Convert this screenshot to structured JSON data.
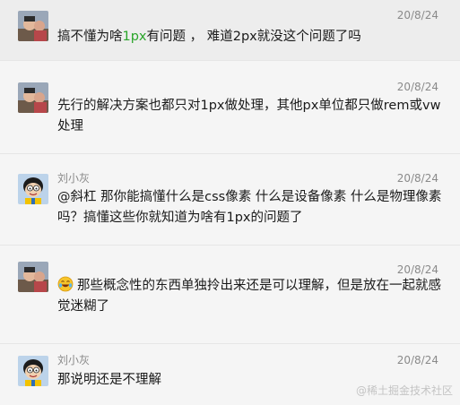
{
  "comments": [
    {
      "author": "",
      "time": "20/8/24",
      "text_pre": "搞不懂为啥",
      "text_highlight": "1px",
      "text_post": "有问题 ， 难道2px就没这个问题了吗"
    },
    {
      "author": "",
      "time": "20/8/24",
      "text": "先行的解决方案也都只对1px做处理，其他px单位都只做rem或vw处理"
    },
    {
      "author": "刘小灰",
      "time": "20/8/24",
      "text": "@斜杠 那你能搞懂什么是css像素 什么是设备像素 什么是物理像素吗？搞懂这些你就知道为啥有1px的问题了"
    },
    {
      "author": "",
      "time": "20/8/24",
      "emoji": "laughing-tears-icon",
      "text": "那些概念性的东西单独拎出来还是可以理解，但是放在一起就感觉迷糊了"
    },
    {
      "author": "刘小灰",
      "time": "20/8/24",
      "text": "那说明还是不理解"
    }
  ],
  "watermark": "@稀土掘金技术社区",
  "colors": {
    "highlight": "#2aa52a",
    "time": "#8a8a8a",
    "text": "#1a1a1a",
    "row_highlight_bg": "#ededed"
  }
}
